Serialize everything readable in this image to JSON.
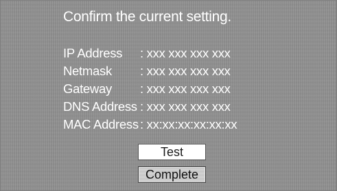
{
  "screen": {
    "title": "Confirm the current setting."
  },
  "settings": [
    {
      "label": "IP Address",
      "value": ": xxx xxx xxx xxx"
    },
    {
      "label": "Netmask",
      "value": ": xxx xxx xxx xxx"
    },
    {
      "label": "Gateway",
      "value": ": xxx xxx xxx xxx"
    },
    {
      "label": "DNS Address",
      "value": ": xxx xxx xxx xxx"
    },
    {
      "label": "MAC Address",
      "value": ": xx:xx:xx:xx:xx:xx"
    }
  ],
  "buttons": {
    "test_label": "Test",
    "complete_label": "Complete",
    "selected": "Complete"
  },
  "colors": {
    "background": "#8f8f8f",
    "text": "#ffffff",
    "button_normal": "#ffffff",
    "button_selected": "#cfcfcf"
  }
}
